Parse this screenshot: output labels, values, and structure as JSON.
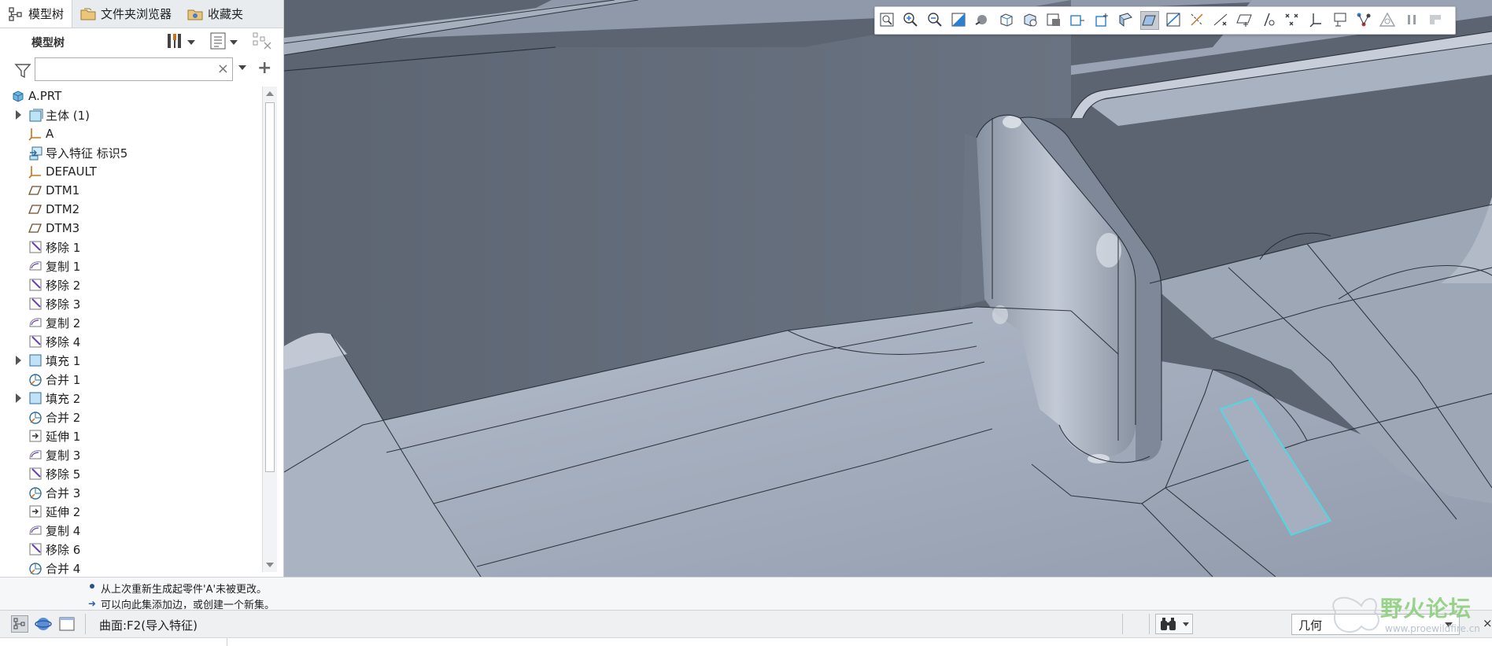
{
  "tabs": [
    {
      "label": "模型树",
      "icon": "model-tree-icon"
    },
    {
      "label": "文件夹浏览器",
      "icon": "folder-browser-icon"
    },
    {
      "label": "收藏夹",
      "icon": "favorites-icon"
    }
  ],
  "tree_header": {
    "title": "模型树"
  },
  "search": {
    "placeholder": "",
    "value": ""
  },
  "tree": [
    {
      "label": "A.PRT",
      "icon": "part-icon",
      "level": 0,
      "expandable": false
    },
    {
      "label": "主体 (1)",
      "icon": "body-icon",
      "level": 1,
      "expandable": true
    },
    {
      "label": "A",
      "icon": "csys-icon",
      "level": 1,
      "expandable": false
    },
    {
      "label": "导入特征 标识5",
      "icon": "import-feature-icon",
      "level": 1,
      "expandable": false
    },
    {
      "label": "DEFAULT",
      "icon": "csys-icon",
      "level": 1,
      "expandable": false
    },
    {
      "label": "DTM1",
      "icon": "datum-plane-icon",
      "level": 1,
      "expandable": false
    },
    {
      "label": "DTM2",
      "icon": "datum-plane-icon",
      "level": 1,
      "expandable": false
    },
    {
      "label": "DTM3",
      "icon": "datum-plane-icon",
      "level": 1,
      "expandable": false
    },
    {
      "label": "移除 1",
      "icon": "remove-icon",
      "level": 1,
      "expandable": false
    },
    {
      "label": "复制 1",
      "icon": "copy-icon",
      "level": 1,
      "expandable": false
    },
    {
      "label": "移除 2",
      "icon": "remove-icon",
      "level": 1,
      "expandable": false
    },
    {
      "label": "移除 3",
      "icon": "remove-icon",
      "level": 1,
      "expandable": false
    },
    {
      "label": "复制 2",
      "icon": "copy-icon",
      "level": 1,
      "expandable": false
    },
    {
      "label": "移除 4",
      "icon": "remove-icon",
      "level": 1,
      "expandable": false
    },
    {
      "label": "填充 1",
      "icon": "fill-icon",
      "level": 1,
      "expandable": true
    },
    {
      "label": "合并 1",
      "icon": "merge-icon",
      "level": 1,
      "expandable": false
    },
    {
      "label": "填充 2",
      "icon": "fill-icon",
      "level": 1,
      "expandable": true
    },
    {
      "label": "合并 2",
      "icon": "merge-icon",
      "level": 1,
      "expandable": false
    },
    {
      "label": "延伸 1",
      "icon": "extend-icon",
      "level": 1,
      "expandable": false
    },
    {
      "label": "复制 3",
      "icon": "copy-icon",
      "level": 1,
      "expandable": false
    },
    {
      "label": "移除 5",
      "icon": "remove-icon",
      "level": 1,
      "expandable": false
    },
    {
      "label": "合并 3",
      "icon": "merge-icon",
      "level": 1,
      "expandable": false
    },
    {
      "label": "延伸 2",
      "icon": "extend-icon",
      "level": 1,
      "expandable": false
    },
    {
      "label": "复制 4",
      "icon": "copy-icon",
      "level": 1,
      "expandable": false
    },
    {
      "label": "移除 6",
      "icon": "remove-icon",
      "level": 1,
      "expandable": false
    },
    {
      "label": "合并 4",
      "icon": "merge-icon",
      "level": 1,
      "expandable": false
    }
  ],
  "toolbar_buttons": [
    "refit-icon",
    "zoom-in-icon",
    "zoom-out-icon",
    "repaint-icon",
    "shading-icon",
    "display-style-icon",
    "saved-orientations-icon",
    "view-manager-icon",
    "perspective-icon",
    "spin-center-icon",
    "shaded-with-edges-icon",
    "shaded-icon",
    "plane-display-icon",
    "axis-display-icon",
    "point-display-icon",
    "csys-display-icon",
    "annotation-display-icon",
    "point-tag-icon",
    "csys-tag-icon",
    "plane-tag-icon",
    "network-icon",
    "analysis-icon",
    "pause-icon",
    "flag-icon"
  ],
  "selected_toolbar_index": 11,
  "messages": [
    "从上次重新生成起零件'A'未被更改。",
    "可以向此集添加边，或创建一个新集。"
  ],
  "status": {
    "selection": "曲面:F2(导入特征)",
    "filter": "几何"
  },
  "watermark": {
    "text": "野火论坛",
    "url": "www.proewildfire.cn"
  },
  "colors": {
    "viewport_bg": "#5e6674",
    "model_surface": "#a4adbb",
    "highlight": "#3fe0ea"
  }
}
